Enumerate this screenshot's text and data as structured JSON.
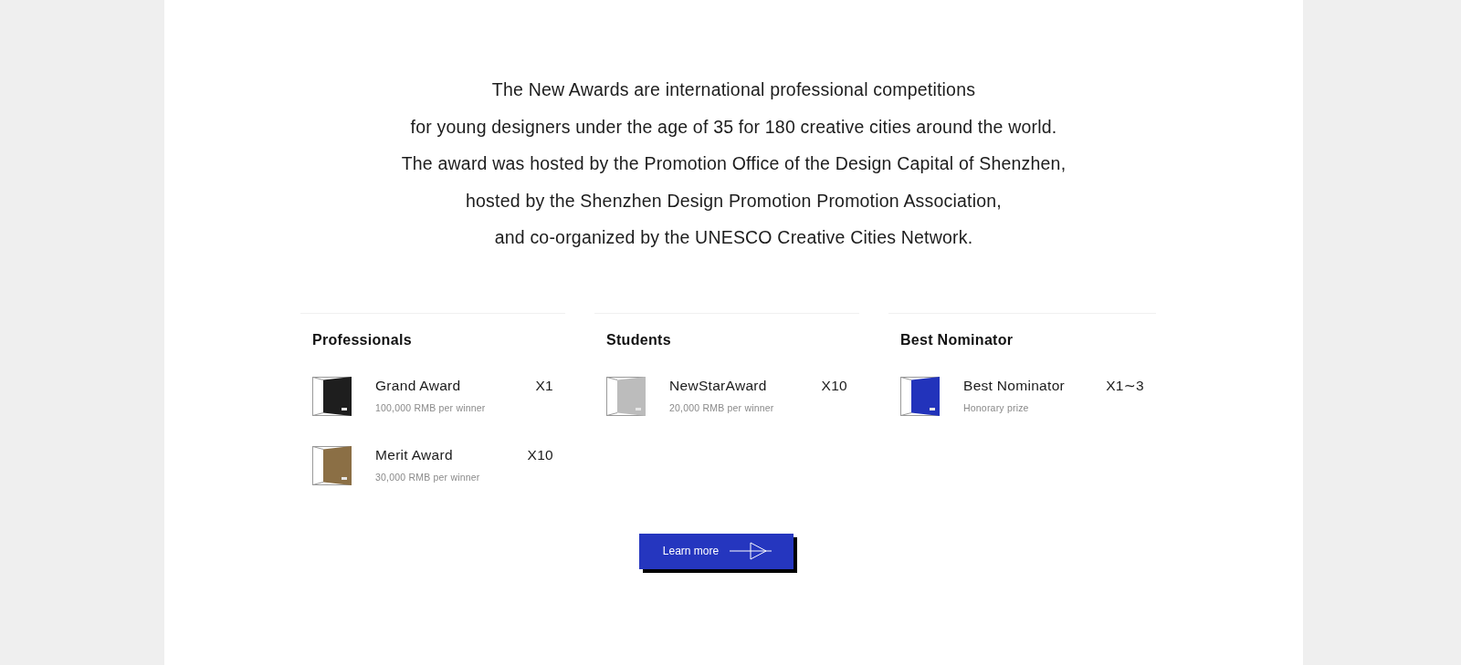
{
  "intro": {
    "lines": [
      "The New Awards are international professional competitions",
      "for young designers under the age of 35 for 180 creative cities around the world.",
      "The award was hosted by the Promotion Office of the Design Capital of Shenzhen,",
      "hosted by the Shenzhen Design Promotion Promotion Association,",
      "and co-organized by the UNESCO Creative Cities Network."
    ]
  },
  "categories": [
    {
      "title": "Professionals",
      "awards": [
        {
          "name": "Grand Award",
          "count": "X1",
          "prize": "100,000 RMB per winner",
          "color": "#1e1e1e"
        },
        {
          "name": "Merit Award",
          "count": "X10",
          "prize": "30,000 RMB per winner",
          "color": "#8b6f45"
        }
      ]
    },
    {
      "title": "Students",
      "awards": [
        {
          "name": "NewStarAward",
          "count": "X10",
          "prize": "20,000 RMB per winner",
          "color": "#bcbcbc"
        }
      ]
    },
    {
      "title": "Best Nominator",
      "awards": [
        {
          "name": "Best Nominator",
          "count": "X1∼3",
          "prize": "Honorary prize",
          "color": "#2233bb"
        }
      ]
    }
  ],
  "button": {
    "label": "Learn more"
  }
}
